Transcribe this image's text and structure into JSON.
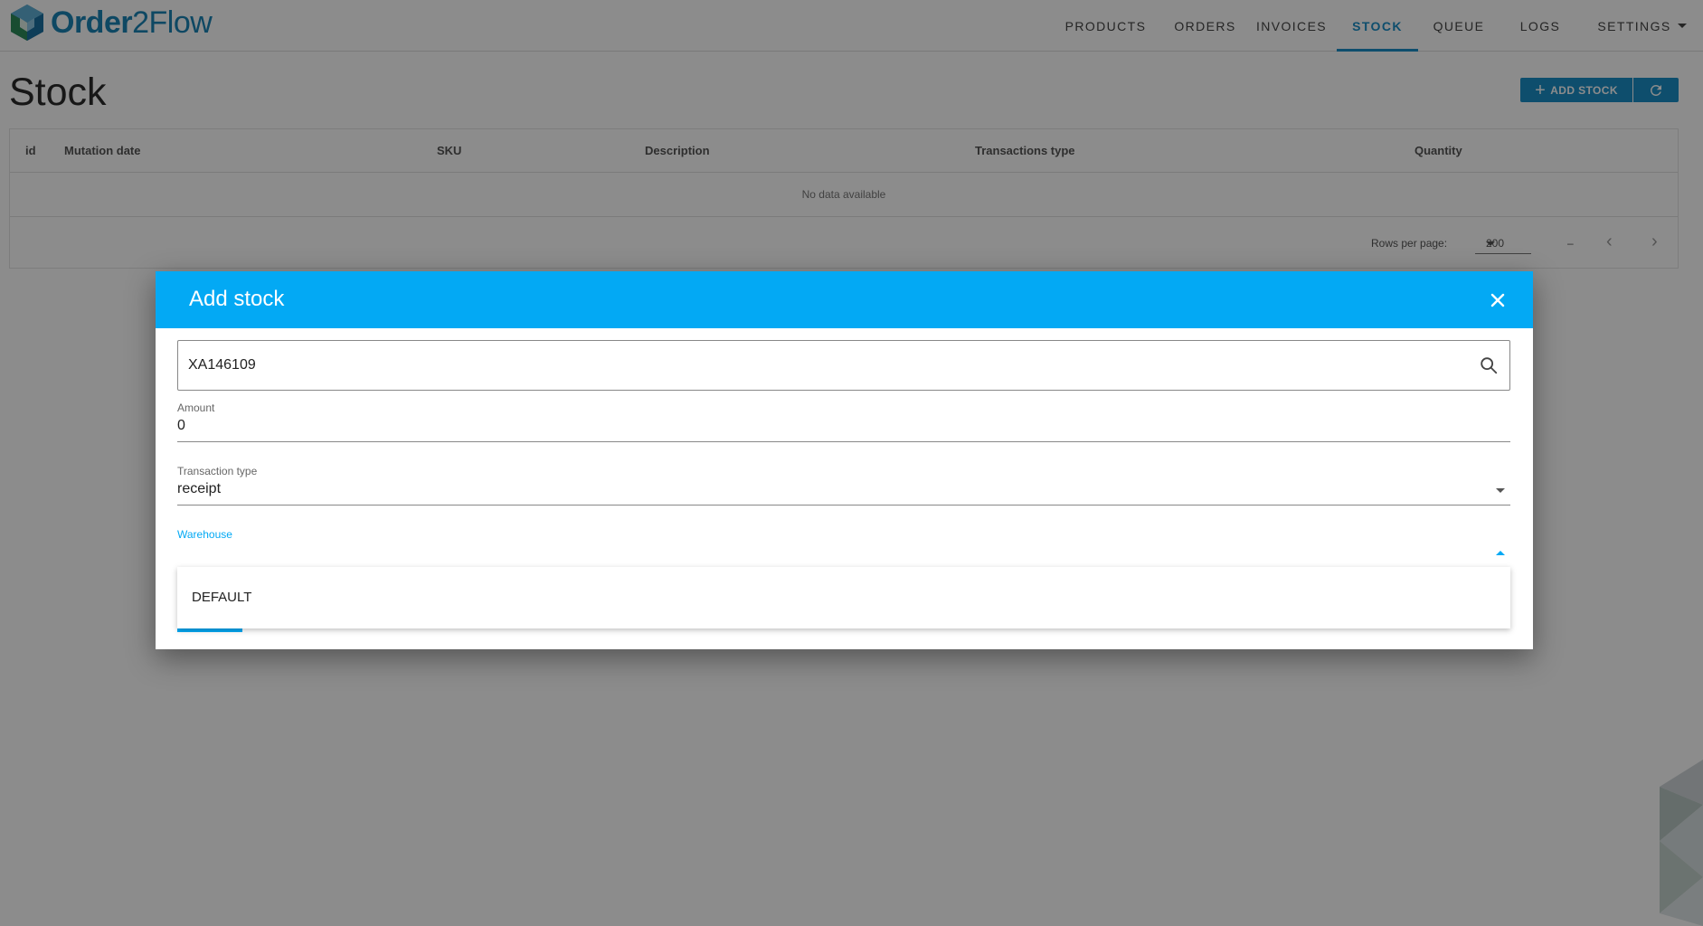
{
  "app": {
    "logo_text_bold": "Order",
    "logo_text_rest": "2Flow"
  },
  "nav": {
    "items": [
      {
        "label": "PRODUCTS",
        "active": false
      },
      {
        "label": "ORDERS",
        "active": false
      },
      {
        "label": "INVOICES",
        "active": false
      },
      {
        "label": "STOCK",
        "active": true
      },
      {
        "label": "QUEUE",
        "active": false
      },
      {
        "label": "LOGS",
        "active": false
      },
      {
        "label": "SETTINGS",
        "active": false,
        "has_dropdown": true
      }
    ]
  },
  "page": {
    "title": "Stock",
    "add_button_label": "ADD STOCK",
    "add_button_icon": "plus-icon",
    "refresh_button_icon": "refresh-icon"
  },
  "table": {
    "columns": [
      "id",
      "Mutation date",
      "SKU",
      "Description",
      "Transactions type",
      "Quantity"
    ],
    "empty_text": "No data available",
    "rows_per_page_label": "Rows per page:",
    "rows_per_page_value": "200",
    "range_text": "–"
  },
  "dialog": {
    "title": "Add stock",
    "search_value": "XA146109",
    "amount_label": "Amount",
    "amount_value": "0",
    "transaction_type_label": "Transaction type",
    "transaction_type_value": "receipt",
    "warehouse_label": "Warehouse",
    "warehouse_value": "",
    "warehouse_options": [
      "DEFAULT"
    ]
  },
  "colors": {
    "accent": "#03a9f4",
    "primary": "#1b8fc7",
    "overlay": "rgba(0,0,0,0.45)"
  }
}
